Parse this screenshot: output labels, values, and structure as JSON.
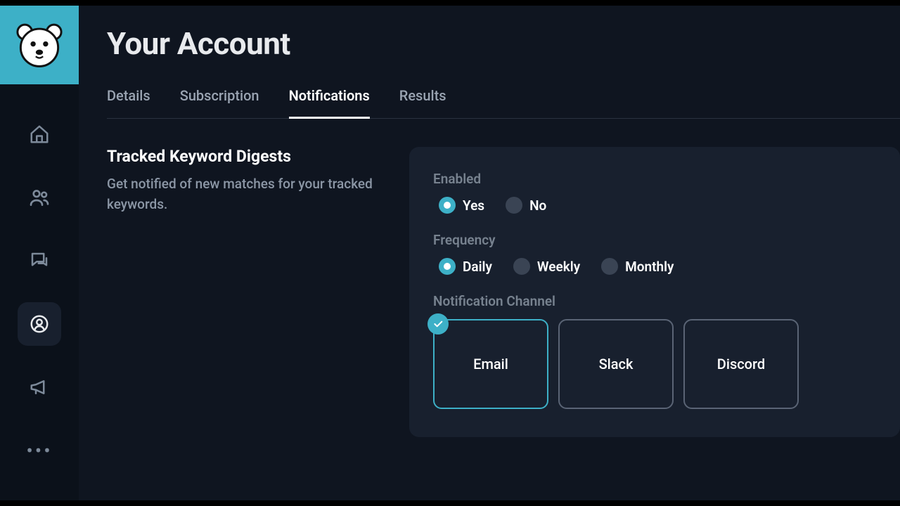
{
  "page": {
    "title": "Your Account"
  },
  "tabs": [
    {
      "label": "Details",
      "active": false
    },
    {
      "label": "Subscription",
      "active": false
    },
    {
      "label": "Notifications",
      "active": true
    },
    {
      "label": "Results",
      "active": false
    }
  ],
  "section": {
    "title": "Tracked Keyword Digests",
    "description": "Get notified of new matches for your tracked keywords."
  },
  "settings": {
    "enabled": {
      "label": "Enabled",
      "options": [
        {
          "label": "Yes",
          "selected": true
        },
        {
          "label": "No",
          "selected": false
        }
      ]
    },
    "frequency": {
      "label": "Frequency",
      "options": [
        {
          "label": "Daily",
          "selected": true
        },
        {
          "label": "Weekly",
          "selected": false
        },
        {
          "label": "Monthly",
          "selected": false
        }
      ]
    },
    "channel": {
      "label": "Notification Channel",
      "options": [
        {
          "label": "Email",
          "selected": true
        },
        {
          "label": "Slack",
          "selected": false
        },
        {
          "label": "Discord",
          "selected": false
        }
      ]
    }
  },
  "sidebar": {
    "items": [
      {
        "name": "home",
        "active": false
      },
      {
        "name": "community",
        "active": false
      },
      {
        "name": "chat",
        "active": false
      },
      {
        "name": "account",
        "active": true
      },
      {
        "name": "announcements",
        "active": false
      },
      {
        "name": "more",
        "active": false
      }
    ]
  }
}
